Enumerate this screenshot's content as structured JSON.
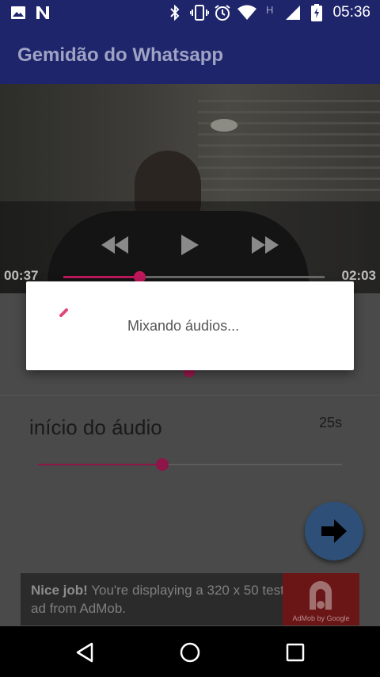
{
  "status_bar": {
    "time": "05:36",
    "icons": [
      "image-icon",
      "n-notification-icon",
      "bluetooth-icon",
      "vibrate-icon",
      "alarm-icon",
      "wifi-icon",
      "h-network-icon",
      "signal-icon",
      "battery-charging-icon"
    ],
    "network_label": "H"
  },
  "app_bar": {
    "title": "Gemidão do Whatsapp"
  },
  "video_player": {
    "current_time": "00:37",
    "duration": "02:03",
    "progress": 0.29,
    "controls": [
      "rewind-icon",
      "play-icon",
      "fast-forward-icon"
    ]
  },
  "settings": {
    "start_label": "início do áudio",
    "start_value": "25s",
    "start_progress": 0.41
  },
  "fab": {
    "icon": "arrow-right-icon"
  },
  "ad": {
    "headline": "Nice job!",
    "body": " You're displaying a 320 x 50 test ad from AdMob.",
    "caption": "AdMob by Google"
  },
  "dialog": {
    "message": "Mixando áudios..."
  },
  "nav_bar": {
    "buttons": [
      "back-icon",
      "home-icon",
      "recents-icon"
    ]
  },
  "colors": {
    "primary": "#1f256b",
    "accent": "#c2185b"
  }
}
